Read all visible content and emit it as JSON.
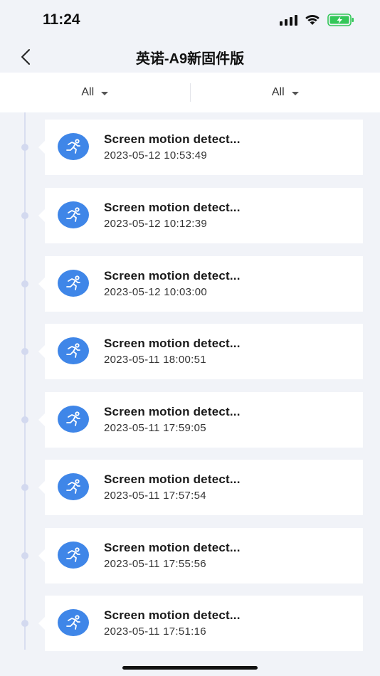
{
  "status_bar": {
    "time": "11:24"
  },
  "nav": {
    "title": "英诺-A9新固件版",
    "back_icon": "chevron-left-icon"
  },
  "filters": [
    {
      "label": "All"
    },
    {
      "label": "All"
    }
  ],
  "events": [
    {
      "title": "Screen motion detect...",
      "time": "2023-05-12 10:53:49",
      "icon": "running-person-icon"
    },
    {
      "title": "Screen motion detect...",
      "time": "2023-05-12 10:12:39",
      "icon": "running-person-icon"
    },
    {
      "title": "Screen motion detect...",
      "time": "2023-05-12 10:03:00",
      "icon": "running-person-icon"
    },
    {
      "title": "Screen motion detect...",
      "time": "2023-05-11 18:00:51",
      "icon": "running-person-icon"
    },
    {
      "title": "Screen motion detect...",
      "time": "2023-05-11 17:59:05",
      "icon": "running-person-icon"
    },
    {
      "title": "Screen motion detect...",
      "time": "2023-05-11 17:57:54",
      "icon": "running-person-icon"
    },
    {
      "title": "Screen motion detect...",
      "time": "2023-05-11 17:55:56",
      "icon": "running-person-icon"
    },
    {
      "title": "Screen motion detect...",
      "time": "2023-05-11 17:51:16",
      "icon": "running-person-icon"
    }
  ],
  "colors": {
    "accent": "#3f86e8",
    "background": "#f1f3f8",
    "timeline": "#d9def0",
    "battery_charging": "#34c759"
  }
}
